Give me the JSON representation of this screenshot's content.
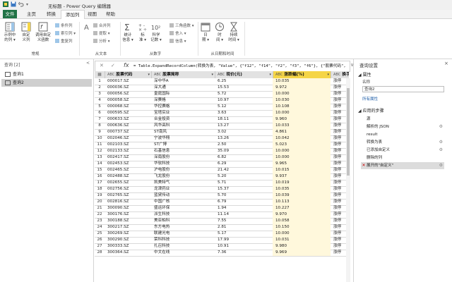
{
  "window": {
    "title": "无标题 - Power Query 编辑器"
  },
  "ribbon_tabs": [
    "文件",
    "主页",
    "转换",
    "添加列",
    "视图",
    "帮助"
  ],
  "ribbon": {
    "buttons": {
      "example": "示例中\n的列 ▾",
      "custom": "自定\n义列",
      "invoke": "调用自定\n义函数",
      "stats": "统计\n信息 ▾",
      "standard": "标\n准 ▾",
      "scientific": "科学\n记数 ▾",
      "date": "日\n期 ▾",
      "time": "时\n间 ▾",
      "duration": "持续\n时间 ▾"
    },
    "small": {
      "cond_col": "条件列",
      "index_col": "索引列 ▾",
      "dup_col": "重复列",
      "format": "格式 ▾",
      "extract": "提取 ▾",
      "parse": "分析 ▾",
      "trig": "三角函数 ▾",
      "round": "舍入 ▾",
      "info": "信息 ▾",
      "merge": "合并列"
    },
    "groups": {
      "general": "常规",
      "from_text": "从文本",
      "from_number": "从数字",
      "from_datetime": "从日期和时间"
    }
  },
  "left_pane": {
    "title": "查询 [2]",
    "collapse": "<",
    "queries": [
      "查询1",
      "查询2"
    ],
    "selected": 1
  },
  "formula_bar": {
    "formula": "= Table.ExpandRecordColumn(转换为表, \"Value\", {\"f12\", \"f14\", \"f2\", \"f3\", \"f6\"}, {\"股票代码\", \"股票简称\", \"现价(元)\", \"涨跌幅(%)\", \"换手\"})",
    "expand": "∨"
  },
  "table": {
    "columns": [
      "股票代码",
      "股票简称",
      "现价(元)",
      "涨跌幅(%)",
      "换手率(%)"
    ],
    "type_icons": [
      "ABC",
      "ABC",
      "ABC",
      "ABC",
      "ABC"
    ],
    "rows": [
      [
        "000017.SZ",
        "深中华A",
        "6.25",
        "10.035",
        "涨停"
      ],
      [
        "000036.SZ",
        "深大通",
        "15.53",
        "9.972",
        "涨停"
      ],
      [
        "000056.SZ",
        "皇庭国际",
        "5.72",
        "10.000",
        "涨停"
      ],
      [
        "000058.SZ",
        "深赛格",
        "10.97",
        "10.030",
        "涨停"
      ],
      [
        "000068.SZ",
        "华控赛格",
        "5.12",
        "10.108",
        "涨停"
      ],
      [
        "000595.SZ",
        "宝塔实业",
        "3.63",
        "10.000",
        "涨停"
      ],
      [
        "000633.SZ",
        "合金投资",
        "18.11",
        "9.960",
        "涨停"
      ],
      [
        "000636.SZ",
        "风华高科",
        "13.27",
        "10.033",
        "涨停"
      ],
      [
        "000737.SZ",
        "ST南风",
        "3.02",
        "4.861",
        "涨停"
      ],
      [
        "002046.SZ",
        "宁波华翔",
        "13.26",
        "10.042",
        "涨停"
      ],
      [
        "002103.SZ",
        "ST广博",
        "2.50",
        "5.023",
        "涨停"
      ],
      [
        "002133.SZ",
        "石基信息",
        "35.09",
        "10.000",
        "涨停"
      ],
      [
        "002417.SZ",
        "深南股份",
        "6.82",
        "10.000",
        "涨停"
      ],
      [
        "002453.SZ",
        "华软科技",
        "6.29",
        "9.965",
        "涨停"
      ],
      [
        "002465.SZ",
        "沪电股份",
        "21.42",
        "10.015",
        "涨停"
      ],
      [
        "002488.SZ",
        "飞龙股份",
        "5.20",
        "9.937",
        "涨停"
      ],
      [
        "002655.SZ",
        "凯美特气",
        "5.71",
        "10.019",
        "涨停"
      ],
      [
        "002756.SZ",
        "龙津药业",
        "15.37",
        "10.035",
        "涨停"
      ],
      [
        "002765.SZ",
        "蓝黛传动",
        "5.70",
        "10.039",
        "涨停"
      ],
      [
        "002816.SZ",
        "中国广核",
        "6.79",
        "10.113",
        "涨停"
      ],
      [
        "300090.SZ",
        "盛运环保",
        "1.94",
        "10.227",
        "涨停"
      ],
      [
        "300176.SZ",
        "派生科技",
        "11.14",
        "9.970",
        "涨停"
      ],
      [
        "300188.SZ",
        "美亚柏科",
        "7.55",
        "10.058",
        "涨停"
      ],
      [
        "300217.SZ",
        "东方电热",
        "2.81",
        "10.150",
        "涨停"
      ],
      [
        "300269.SZ",
        "联建光电",
        "5.17",
        "10.000",
        "涨停"
      ],
      [
        "300290.SZ",
        "荣科科技",
        "17.99",
        "10.031",
        "涨停"
      ],
      [
        "300333.SZ",
        "扎召科技",
        "10.91",
        "9.980",
        "涨停"
      ],
      [
        "300364.SZ",
        "中文在线",
        "7.36",
        "9.969",
        "涨停"
      ]
    ]
  },
  "right_pane": {
    "title": "查询设置",
    "close": "×",
    "properties_title": "◢ 属性",
    "name_label": "名称",
    "name_value": "查询2",
    "all_properties": "所有属性",
    "steps_title": "◢ 应用的步骤",
    "steps": [
      "源",
      "解析的 JSON",
      "result",
      "转换为表",
      "已添加自定义",
      "删除的列",
      "展开的\"自定义\""
    ],
    "step_gears": [
      false,
      true,
      false,
      true,
      true,
      false,
      true
    ],
    "selected_step": 6
  },
  "colors": {
    "accent": "#217346",
    "header_bg": "#e2e2e2",
    "column_highlight": "#f5d547",
    "grid_line": "#dadada"
  }
}
